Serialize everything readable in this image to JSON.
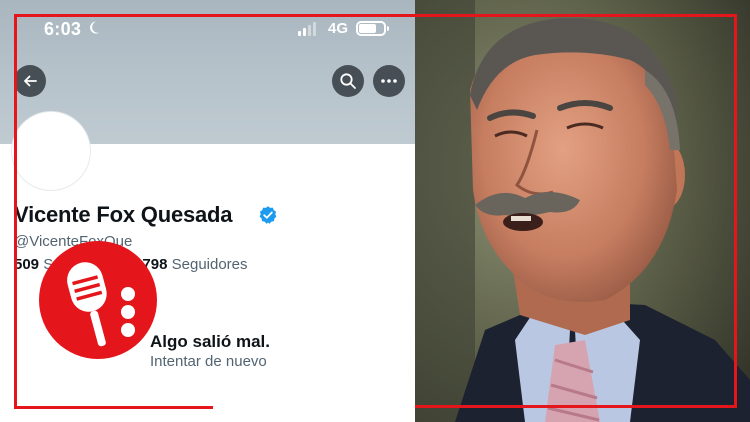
{
  "status": {
    "time": "6:03",
    "network": "4G",
    "battery_level": 0.7
  },
  "profile": {
    "display_name": "Vicente Fox Quesada",
    "handle": "@VicenteFoxQue",
    "following_count": "509",
    "following_label": "S",
    "followers_count": "98,798",
    "followers_label": "Seguidores",
    "handle_visible_tail": "@VicenteFoxQue"
  },
  "error": {
    "title": "Algo salió mal.",
    "retry": "Intentar de nuevo"
  },
  "icons": {
    "back": "arrow-left-icon",
    "search": "search-icon",
    "more": "more-horizontal-icon",
    "verified": "verified-badge-icon",
    "logo": "podcast-microphone-logo"
  },
  "colors": {
    "frame_red": "#e5161b",
    "verified_blue": "#1d9bf0",
    "banner": "#b7c3cb",
    "text_primary": "#0f1419",
    "text_secondary": "#536471"
  }
}
